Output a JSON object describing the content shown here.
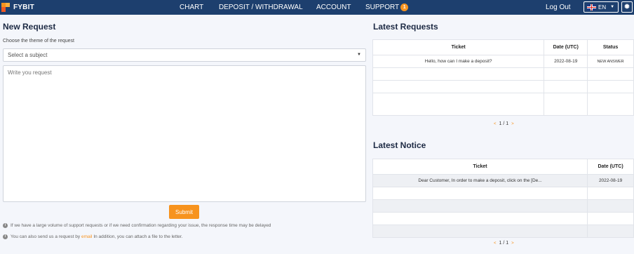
{
  "header": {
    "logo_text": "FYBIT",
    "nav": [
      {
        "label": "CHART"
      },
      {
        "label": "DEPOSIT / WITHDRAWAL"
      },
      {
        "label": "ACCOUNT"
      },
      {
        "label": "SUPPORT",
        "badge": "1"
      }
    ],
    "logout": "Log Out",
    "language": "EN",
    "icons": {
      "flag": "uk-flag-icon",
      "settings": "gear-icon"
    }
  },
  "new_request": {
    "title": "New Request",
    "theme_label": "Choose the theme of the request",
    "subject_select": "Select a subject",
    "message_placeholder": "Write you request",
    "submit_label": "Submit",
    "note1": "If we have a large volume of support requests or if we need confirmation regarding your issue, the response time may be delayed",
    "note2_prefix": "You can also send us a request by",
    "note2_link": "email",
    "note2_suffix": "In addition, you can attach a file to the letter."
  },
  "latest_requests": {
    "title": "Latest Requests",
    "columns": [
      "Ticket",
      "Date (UTC)",
      "Status"
    ],
    "rows": [
      {
        "ticket": "Hello, how can I make a deposit?",
        "date": "2022-08-19",
        "status": "NEW ANSWER"
      }
    ],
    "pager": "1 / 1"
  },
  "latest_notice": {
    "title": "Latest Notice",
    "columns": [
      "Ticket",
      "Date (UTC)"
    ],
    "rows": [
      {
        "ticket": "Dear Customer, In order to make a deposit, click on the [De...",
        "date": "2022-08-19"
      }
    ],
    "pager": "1 / 1"
  },
  "colors": {
    "nav_bg": "#1d3f6e",
    "accent": "#f7931e",
    "page_bg": "#f4f6fb"
  }
}
